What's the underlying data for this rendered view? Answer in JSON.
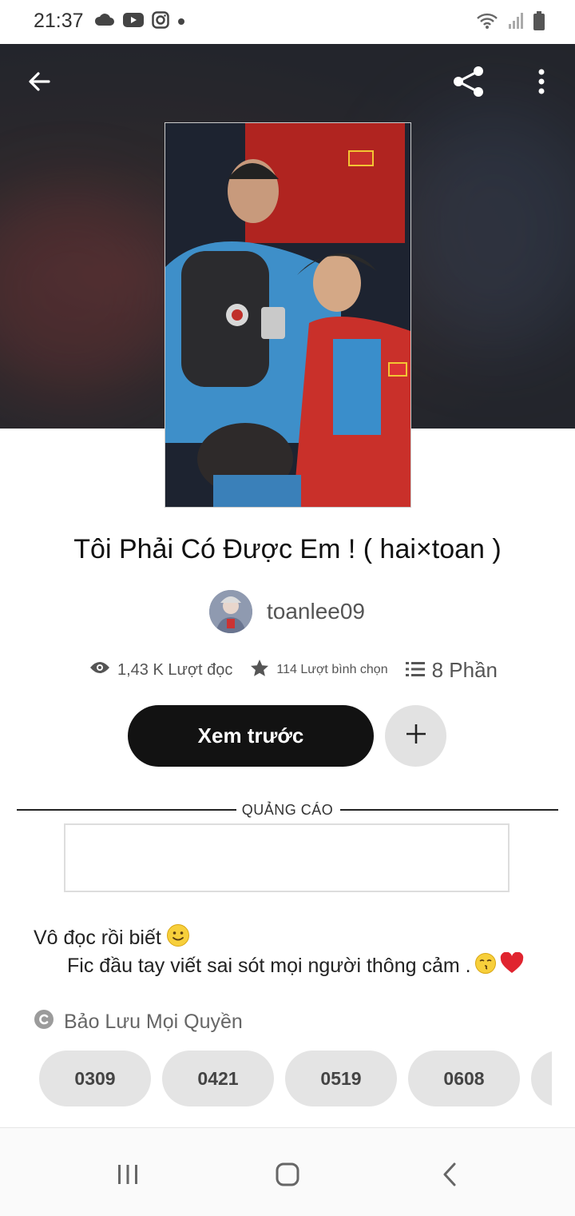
{
  "status_bar": {
    "time": "21:37",
    "left_icons": [
      "cloud-icon",
      "youtube-icon",
      "instagram-icon",
      "dot-icon"
    ],
    "right_icons": [
      "wifi-icon",
      "signal-icon",
      "battery-icon"
    ]
  },
  "toolbar": {
    "back_icon": "arrow-left-icon",
    "share_icon": "share-icon",
    "more_icon": "more-vertical-icon"
  },
  "story": {
    "title": "Tôi Phải Có Được Em ! ( hai×toan )",
    "author": "toanlee09",
    "reads": "1,43 K Lượt đọc",
    "votes": "114 Lượt bình chọn",
    "parts": "8 Phần"
  },
  "actions": {
    "preview_label": "Xem trước",
    "add_icon": "plus-icon"
  },
  "ad": {
    "label": "QUẢNG CÁO"
  },
  "description": {
    "line1": "Vô đọc rồi biết",
    "line2": "Fic đầu tay viết sai sót mọi người thông cảm ."
  },
  "copyright": {
    "icon": "copyright-icon",
    "label": "Bảo Lưu Mọi Quyền"
  },
  "tags": [
    "0309",
    "0421",
    "0519",
    "0608",
    ""
  ],
  "nav": {
    "recents_icon": "recents-icon",
    "home_icon": "home-icon",
    "back_icon": "chevron-left-icon"
  },
  "colors": {
    "primary_button": "#121212",
    "secondary_button": "#e2e2e2",
    "tag_bg": "#e4e4e4"
  }
}
